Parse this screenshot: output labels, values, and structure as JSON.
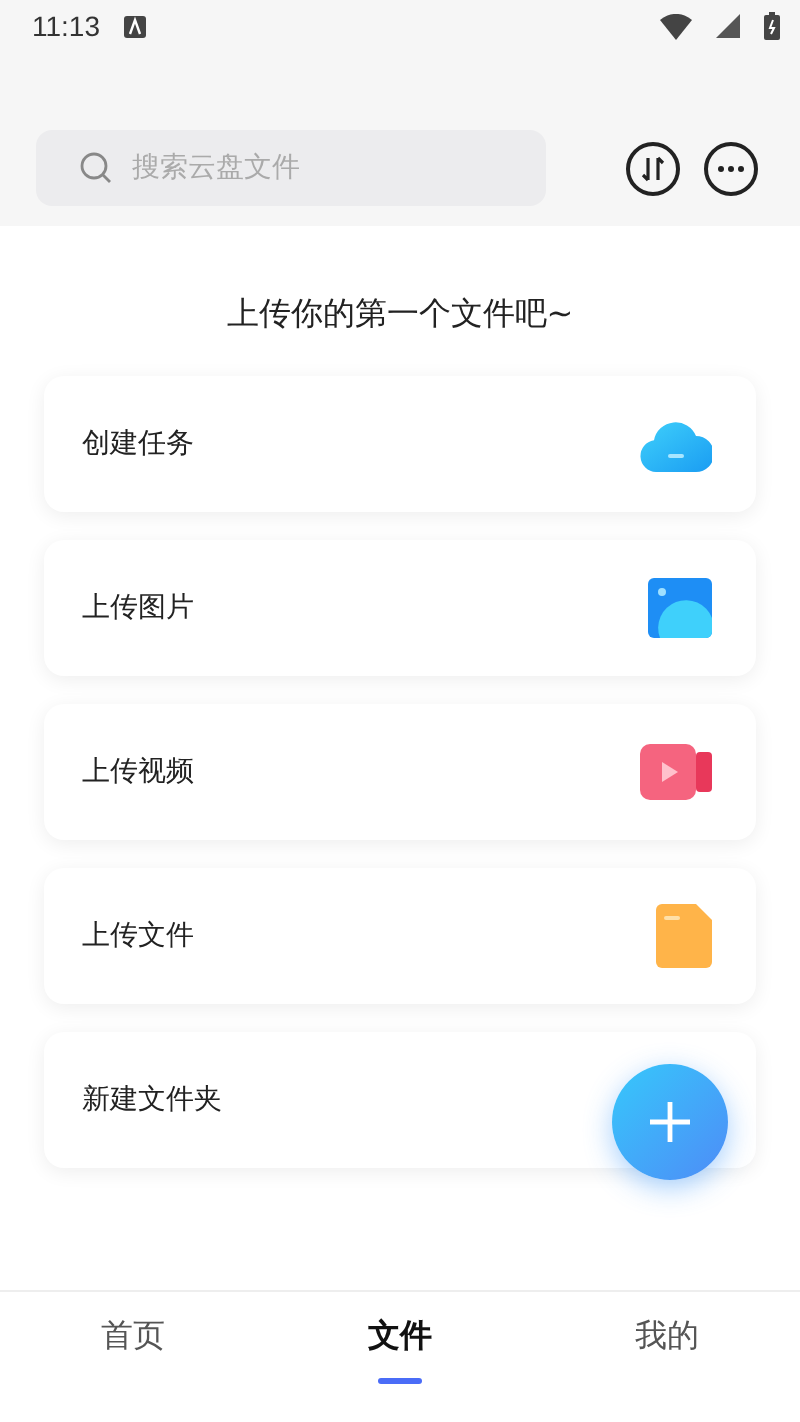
{
  "status_bar": {
    "time": "11:13"
  },
  "search": {
    "placeholder": "搜索云盘文件"
  },
  "headline": "上传你的第一个文件吧~",
  "actions": [
    {
      "label": "创建任务",
      "kind": "cloud"
    },
    {
      "label": "上传图片",
      "kind": "image"
    },
    {
      "label": "上传视频",
      "kind": "video"
    },
    {
      "label": "上传文件",
      "kind": "file"
    },
    {
      "label": "新建文件夹",
      "kind": "plain"
    }
  ],
  "tabs": [
    {
      "label": "首页",
      "selected": false
    },
    {
      "label": "文件",
      "selected": true
    },
    {
      "label": "我的",
      "selected": false
    }
  ]
}
